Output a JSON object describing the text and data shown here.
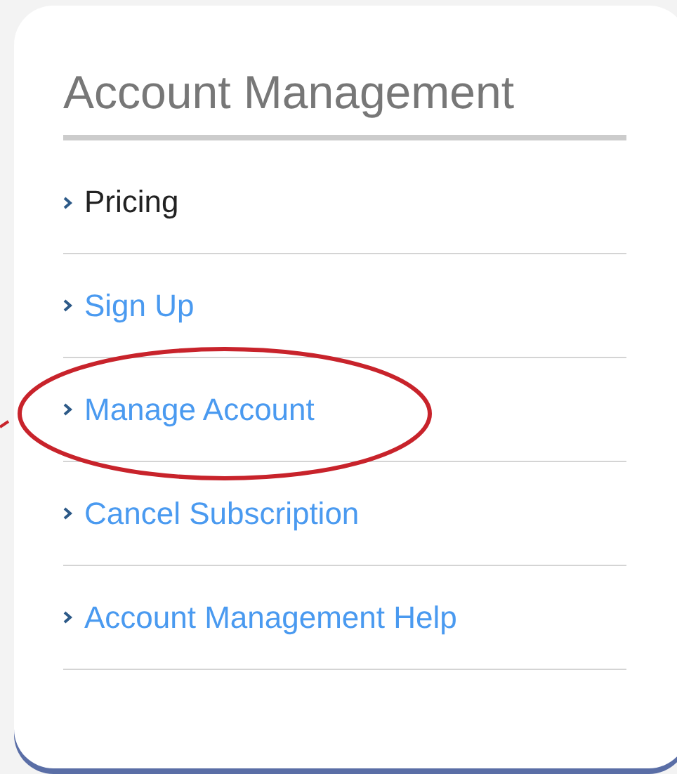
{
  "panel": {
    "title": "Account Management"
  },
  "links": [
    {
      "label": "Pricing",
      "selected": true,
      "circled": false
    },
    {
      "label": "Sign Up",
      "selected": false,
      "circled": false
    },
    {
      "label": "Manage Account",
      "selected": false,
      "circled": true
    },
    {
      "label": "Cancel Subscription",
      "selected": false,
      "circled": false
    },
    {
      "label": "Account Management Help",
      "selected": false,
      "circled": false
    }
  ]
}
